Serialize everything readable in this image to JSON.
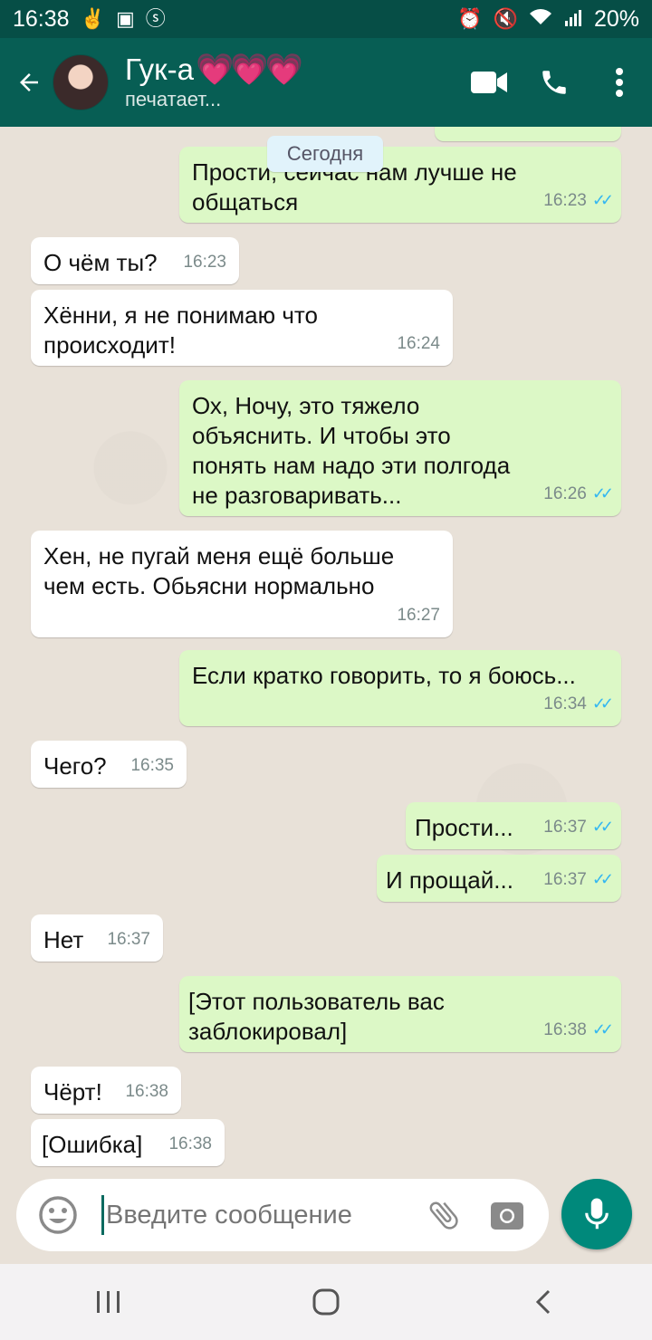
{
  "status_bar": {
    "time": "16:38",
    "battery": "20%"
  },
  "header": {
    "contact_name": "Гук-а",
    "hearts": "💗💗💗",
    "status": "печатает..."
  },
  "date_chip": "Сегодня",
  "messages": [
    {
      "dir": "out",
      "text": "Прости, сейчас нам лучше не общаться",
      "time": "16:23"
    },
    {
      "dir": "in",
      "text": "О чём ты?",
      "time": "16:23"
    },
    {
      "dir": "in",
      "text": "Хённи, я не понимаю что происходит!",
      "time": "16:24"
    },
    {
      "dir": "out",
      "text": "Ох, Ночу, это тяжело объяснить. И чтобы это понять нам надо эти полгода не разговаривать...",
      "time": "16:26"
    },
    {
      "dir": "in",
      "text": "Хен, не пугай меня ещё больше чем есть. Обьясни нормально",
      "time": "16:27"
    },
    {
      "dir": "out",
      "text": "Если кратко говорить, то я боюсь...",
      "time": "16:34"
    },
    {
      "dir": "in",
      "text": "Чего?",
      "time": "16:35"
    },
    {
      "dir": "out",
      "text": "Прости...",
      "time": "16:37"
    },
    {
      "dir": "out",
      "text": "И прощай...",
      "time": "16:37"
    },
    {
      "dir": "in",
      "text": "Нет",
      "time": "16:37"
    },
    {
      "dir": "out",
      "text": "[Этот пользователь вас заблокировал]",
      "time": "16:38"
    },
    {
      "dir": "in",
      "text": "Чёрт!",
      "time": "16:38"
    },
    {
      "dir": "in",
      "text": "[Ошибка]",
      "time": "16:38"
    }
  ],
  "input": {
    "placeholder": "Введите сообщение"
  },
  "colors": {
    "app_bar": "#075e54",
    "status_bar": "#064e46",
    "outgoing": "#dcf8c6",
    "incoming": "#ffffff",
    "mic_button": "#00897b",
    "read_ticks": "#34b7f1"
  },
  "icons": {
    "status_bar": [
      "notification-icon",
      "square-notification-icon",
      "shazam-icon",
      "alarm-icon",
      "mute-icon",
      "wifi-icon",
      "signal-icon"
    ],
    "app_bar": [
      "back-arrow-icon",
      "video-call-icon",
      "phone-icon",
      "more-vert-icon"
    ],
    "input_bar": [
      "emoji-icon",
      "attach-icon",
      "camera-icon",
      "mic-icon"
    ],
    "nav_bar": [
      "recent-apps-icon",
      "home-icon",
      "back-icon"
    ]
  }
}
